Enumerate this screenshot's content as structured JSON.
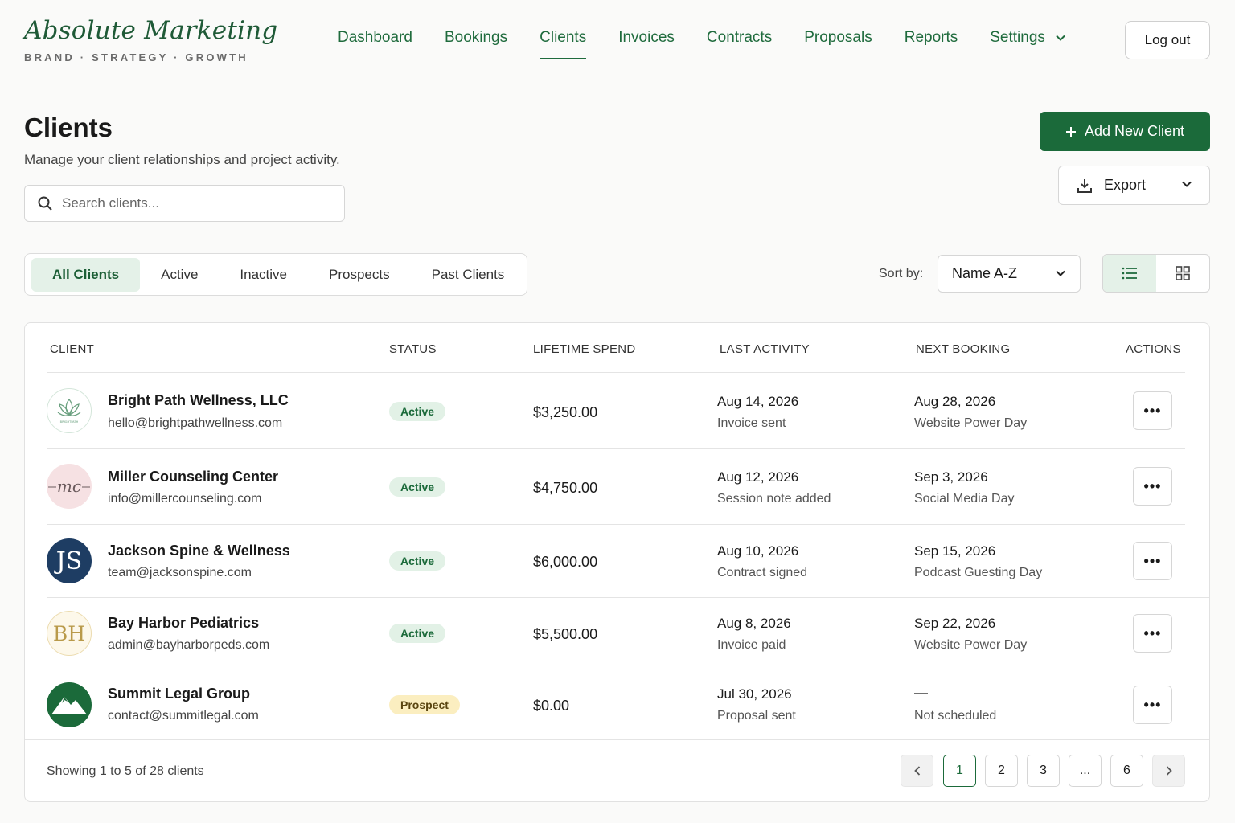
{
  "brand": {
    "name": "Absolute Marketing",
    "tagline": "BRAND · STRATEGY · GROWTH"
  },
  "nav": {
    "items": [
      "Dashboard",
      "Bookings",
      "Clients",
      "Invoices",
      "Contracts",
      "Proposals",
      "Reports",
      "Settings"
    ],
    "active": "Clients",
    "logout_label": "Log out"
  },
  "page": {
    "title": "Clients",
    "subtitle": "Manage your client relationships and project activity."
  },
  "search": {
    "placeholder": "Search clients..."
  },
  "actions": {
    "add_label": "Add New Client",
    "export_label": "Export"
  },
  "filters": {
    "tabs": [
      "All Clients",
      "Active",
      "Inactive",
      "Prospects",
      "Past Clients"
    ],
    "active": "All Clients"
  },
  "sort": {
    "label": "Sort by:",
    "value": "Name A-Z"
  },
  "view": {
    "active": "list"
  },
  "table": {
    "headers": {
      "client": "CLIENT",
      "status": "STATUS",
      "spend": "LIFETIME SPEND",
      "activity": "LAST ACTIVITY",
      "booking": "NEXT BOOKING",
      "actions": "ACTIONS"
    },
    "rows": [
      {
        "name": "Bright Path Wellness, LLC",
        "email": "hello@brightpathwellness.com",
        "status": "Active",
        "spend": "$3,250.00",
        "activity_date": "Aug 14, 2026",
        "activity_note": "Invoice sent",
        "booking_date": "Aug 28, 2026",
        "booking_note": "Website Power Day",
        "avatar_text": "BRIGHTPATH"
      },
      {
        "name": "Miller Counseling Center",
        "email": "info@millercounseling.com",
        "status": "Active",
        "spend": "$4,750.00",
        "activity_date": "Aug 12, 2026",
        "activity_note": "Session note added",
        "booking_date": "Sep 3, 2026",
        "booking_note": "Social Media Day",
        "avatar_text": "mc"
      },
      {
        "name": "Jackson Spine & Wellness",
        "email": "team@jacksonspine.com",
        "status": "Active",
        "spend": "$6,000.00",
        "activity_date": "Aug 10, 2026",
        "activity_note": "Contract signed",
        "booking_date": "Sep 15, 2026",
        "booking_note": "Podcast Guesting Day",
        "avatar_text": "JS"
      },
      {
        "name": "Bay Harbor Pediatrics",
        "email": "admin@bayharborpeds.com",
        "status": "Active",
        "spend": "$5,500.00",
        "activity_date": "Aug 8, 2026",
        "activity_note": "Invoice paid",
        "booking_date": "Sep 22, 2026",
        "booking_note": "Website Power Day",
        "avatar_text": "BH"
      },
      {
        "name": "Summit Legal Group",
        "email": "contact@summitlegal.com",
        "status": "Prospect",
        "spend": "$0.00",
        "activity_date": "Jul 30, 2026",
        "activity_note": "Proposal sent",
        "booking_date": "—",
        "booking_note": "Not scheduled",
        "avatar_text": ""
      }
    ],
    "more_label": "•••"
  },
  "pagination": {
    "summary": "Showing 1 to 5 of 28 clients",
    "pages": [
      "1",
      "2",
      "3",
      "...",
      "6"
    ],
    "current": "1"
  },
  "colors": {
    "brand_green": "#1b6a3a",
    "accent_light": "#e4f1e8",
    "prospect_bg": "#fbeec0"
  }
}
